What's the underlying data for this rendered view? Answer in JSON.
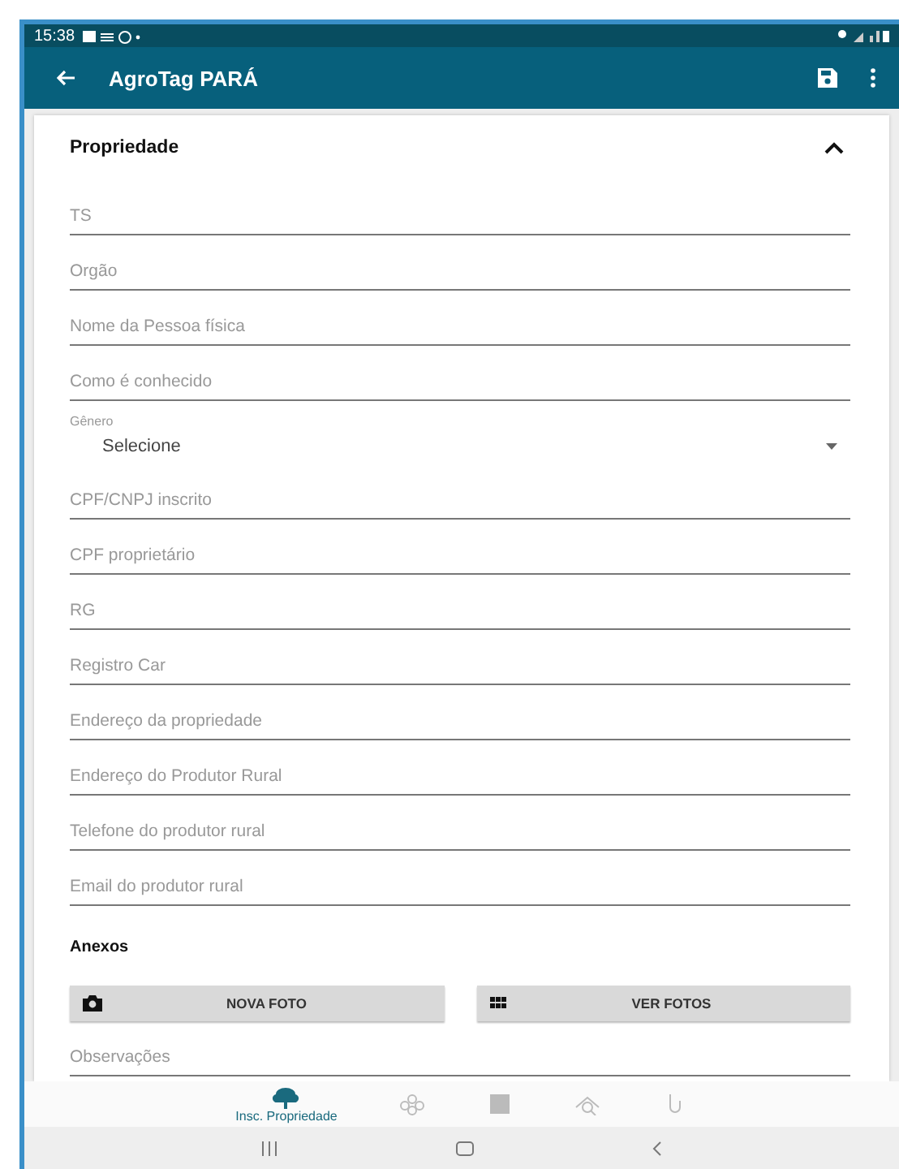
{
  "status_bar": {
    "time": "15:38"
  },
  "app_bar": {
    "title": "AgroTag PARÁ"
  },
  "section": {
    "title": "Propriedade",
    "expanded": true
  },
  "fields": [
    {
      "kind": "text",
      "placeholder": "TS"
    },
    {
      "kind": "text",
      "placeholder": "Orgão"
    },
    {
      "kind": "text",
      "placeholder": "Nome da Pessoa física"
    },
    {
      "kind": "text",
      "placeholder": "Como é conhecido"
    },
    {
      "kind": "select",
      "label": "Gênero",
      "value": "Selecione"
    },
    {
      "kind": "text",
      "placeholder": "CPF/CNPJ inscrito"
    },
    {
      "kind": "text",
      "placeholder": "CPF proprietário"
    },
    {
      "kind": "text",
      "placeholder": "RG"
    },
    {
      "kind": "text",
      "placeholder": "Registro Car"
    },
    {
      "kind": "text",
      "placeholder": "Endereço da propriedade"
    },
    {
      "kind": "text",
      "placeholder": "Endereço do Produtor Rural"
    },
    {
      "kind": "text",
      "placeholder": "Telefone do produtor rural"
    },
    {
      "kind": "text",
      "placeholder": "Email do produtor rural"
    }
  ],
  "attachments": {
    "title": "Anexos",
    "buttons": [
      {
        "kind": "camera",
        "label": "NOVA FOTO"
      },
      {
        "kind": "grid",
        "label": "VER FOTOS"
      }
    ]
  },
  "notes": {
    "placeholder": "Observações"
  },
  "bottom_nav": [
    {
      "kind": "tree",
      "label": "Insc. Propriedade",
      "selected": true
    },
    {
      "kind": "group",
      "selected": false
    },
    {
      "kind": "book",
      "selected": false
    },
    {
      "kind": "search",
      "selected": false
    },
    {
      "kind": "hand",
      "selected": false
    }
  ]
}
